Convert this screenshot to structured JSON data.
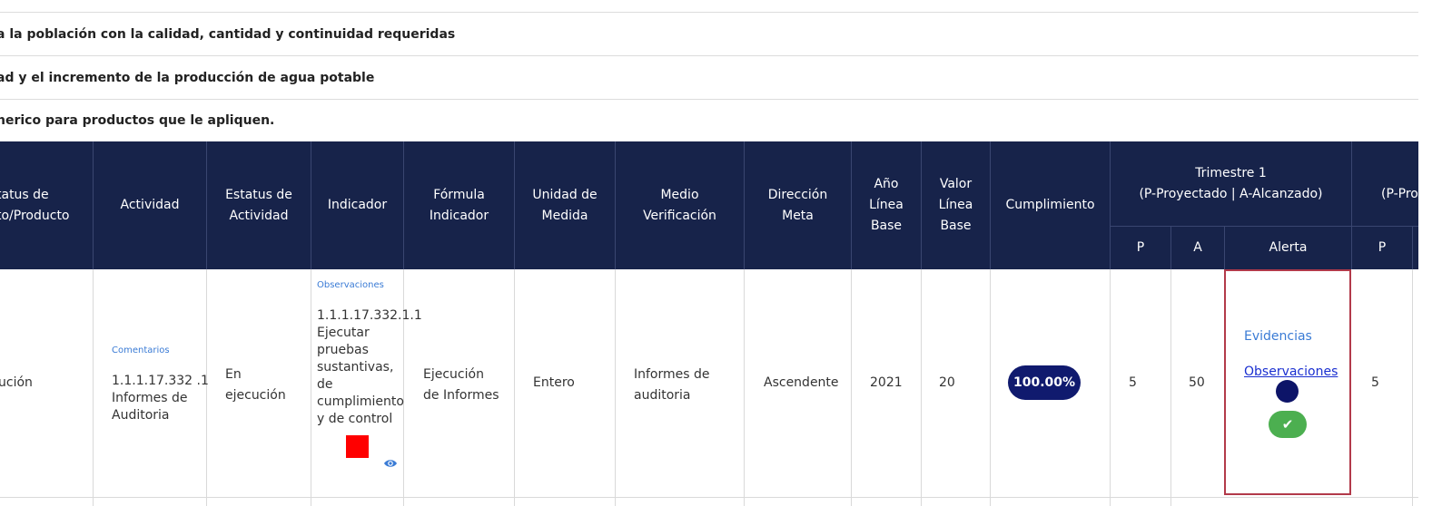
{
  "breadcrumb_rows": [
    "a la población con la calidad, cantidad y continuidad requeridas",
    "ad y el incremento de la producción de agua potable",
    "nerico para productos que le apliquen."
  ],
  "table": {
    "headers": {
      "estatus_proyecto": "tatus de\nto/Producto",
      "actividad": "Actividad",
      "estatus_actividad": "Estatus de\nActividad",
      "indicador": "Indicador",
      "formula": "Fórmula\nIndicador",
      "unidad": "Unidad de\nMedida",
      "medio": "Medio\nVerificación",
      "direccion": "Dirección\nMeta",
      "anio": "Año\nLínea\nBase",
      "valor": "Valor\nLínea\nBase",
      "cumplimiento": "Cumplimiento",
      "trimestre1": "Trimestre 1\n(P-Proyectado | A-Alcanzado)",
      "trimestre2_partial": "(P-Pro",
      "sub_p": "P",
      "sub_a": "A",
      "sub_alerta": "Alerta",
      "sub_p2": "P"
    },
    "row": {
      "estatus_proyecto": "ución",
      "comentarios_link": "Comentarios",
      "actividad": "1.1.1.17.332 .1\nInformes de\nAuditoria",
      "estatus_actividad": "En\nejecución",
      "observaciones_link": "Observaciones",
      "indicador": "1.1.1.17.332.1.1\nEjecutar\npruebas\nsustantivas,\nde\ncumplimiento\ny de control",
      "formula": "Ejecución\nde Informes",
      "unidad": "Entero",
      "medio": "Informes de\nauditoria",
      "direccion": "Ascendente",
      "anio": "2021",
      "valor": "20",
      "cumplimiento": "100.00%",
      "p": "5",
      "a": "50",
      "evidencias_link": "Evidencias",
      "observaciones_alert_link": "Observaciones",
      "p2": "5"
    }
  },
  "colors": {
    "header_bg": "#17234a",
    "pill_bg": "#101a6e",
    "alert_border": "#b23a4a",
    "status_red": "#ff0000",
    "check_green": "#4caf50",
    "link_blue": "#3a7bd5"
  },
  "icons": [
    "eye-icon",
    "check-icon"
  ]
}
